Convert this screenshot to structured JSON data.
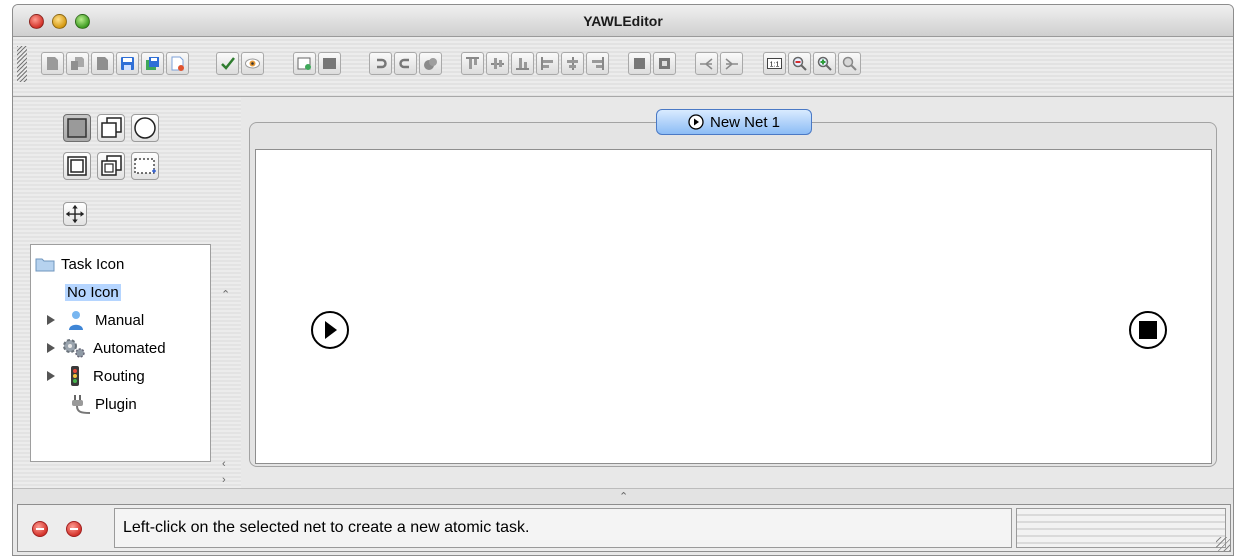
{
  "window": {
    "title": "YAWLEditor"
  },
  "net": {
    "tab_label": "New Net 1"
  },
  "tree": {
    "root": "Task Icon",
    "selected": "No Icon",
    "items": [
      {
        "label": "Manual",
        "icon": "person-icon"
      },
      {
        "label": "Automated",
        "icon": "gears-icon"
      },
      {
        "label": "Routing",
        "icon": "traffic-light-icon"
      },
      {
        "label": "Plugin",
        "icon": "plug-icon"
      }
    ]
  },
  "status": {
    "message": "Left-click on the selected net to create a new atomic task."
  },
  "colors": {
    "tab_accent": "#8cbcf5",
    "selection": "#b5d5ff",
    "save_blue": "#2f6fd6"
  }
}
